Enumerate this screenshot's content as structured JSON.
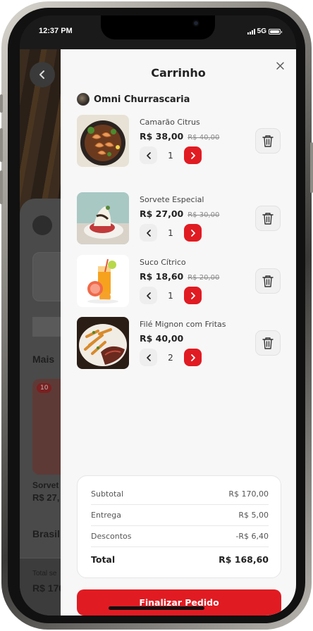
{
  "status_bar": {
    "time": "12:37 PM",
    "network": "5G"
  },
  "background": {
    "texts": [
      {
        "id": "bg-section-1",
        "text": "Mais"
      },
      {
        "id": "bg-badge",
        "text": "10"
      },
      {
        "id": "bg-product-name",
        "text": "Sorvet"
      },
      {
        "id": "bg-product-price",
        "text": "R$ 27,"
      },
      {
        "id": "bg-section-2",
        "text": "Brasil"
      },
      {
        "id": "bg-total-label",
        "text": "Total se"
      },
      {
        "id": "bg-total-value",
        "text": "R$ 170"
      }
    ]
  },
  "cart": {
    "title": "Carrinho",
    "store_name": "Omni Churrascaria",
    "items": [
      {
        "name": "Camarão Citrus",
        "price": "R$ 38,00",
        "old_price": "R$ 40,00",
        "quantity": "1",
        "image": "shrimp-dish"
      },
      {
        "name": "Sorvete Especial",
        "price": "R$ 27,00",
        "old_price": "R$ 30,00",
        "quantity": "1",
        "image": "ice-cream-dessert"
      },
      {
        "name": "Suco Cítrico",
        "price": "R$ 18,60",
        "old_price": "R$ 20,00",
        "quantity": "1",
        "image": "citrus-juice"
      },
      {
        "name": "Filé Mignon com Fritas",
        "price": "R$ 40,00",
        "old_price": "",
        "quantity": "2",
        "image": "steak-fries"
      }
    ],
    "summary": {
      "subtotal_label": "Subtotal",
      "subtotal_value": "R$ 170,00",
      "delivery_label": "Entrega",
      "delivery_value": "R$ 5,00",
      "discount_label": "Descontos",
      "discount_value": "-R$ 6,40",
      "total_label": "Total",
      "total_value": "R$ 168,60"
    },
    "checkout_label": "Finalizar Pedido"
  },
  "colors": {
    "accent": "#e11b22",
    "drawer_bg": "#f7f7f7",
    "text": "#222222"
  },
  "icons": [
    "close-icon",
    "trash-icon",
    "chevron-left-icon",
    "chevron-right-icon",
    "back-arrow-icon"
  ]
}
